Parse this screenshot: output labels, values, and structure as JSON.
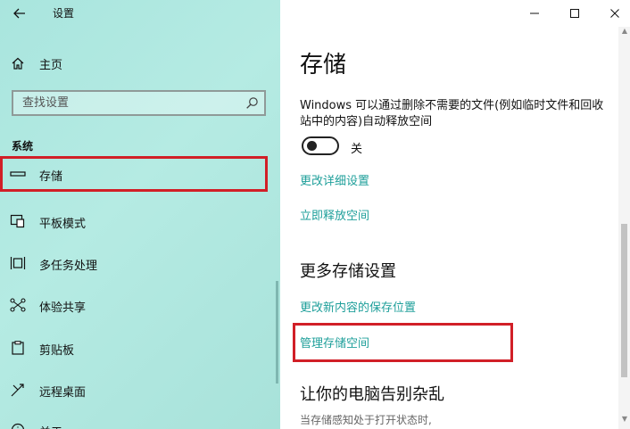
{
  "app": {
    "title": "设置"
  },
  "sidebar": {
    "home_label": "主页",
    "search_placeholder": "查找设置",
    "section_label": "系统",
    "items": [
      {
        "label": "存储",
        "icon": "storage-icon",
        "selected": true
      },
      {
        "label": "平板模式",
        "icon": "tablet-mode-icon"
      },
      {
        "label": "多任务处理",
        "icon": "multitasking-icon"
      },
      {
        "label": "体验共享",
        "icon": "shared-experiences-icon"
      },
      {
        "label": "剪贴板",
        "icon": "clipboard-icon"
      },
      {
        "label": "远程桌面",
        "icon": "remote-desktop-icon"
      },
      {
        "label": "关于",
        "icon": "about-icon"
      }
    ]
  },
  "content": {
    "title": "存储",
    "description": "Windows 可以通过删除不需要的文件(例如临时文件和回收站中的内容)自动释放空间",
    "toggle_label": "关",
    "toggle_on": false,
    "links": {
      "change_details": "更改详细设置",
      "free_now": "立即释放空间",
      "change_save_location": "更改新内容的保存位置",
      "manage_storage_spaces": "管理存储空间"
    },
    "more_heading": "更多存储设置",
    "declutter_heading": "让你的电脑告别杂乱",
    "declutter_desc": "当存储感知处于打开状态时,"
  },
  "colors": {
    "accent": "#1e9f9a",
    "highlight": "#d11f27",
    "sidebar_bg": "#aee6de"
  }
}
